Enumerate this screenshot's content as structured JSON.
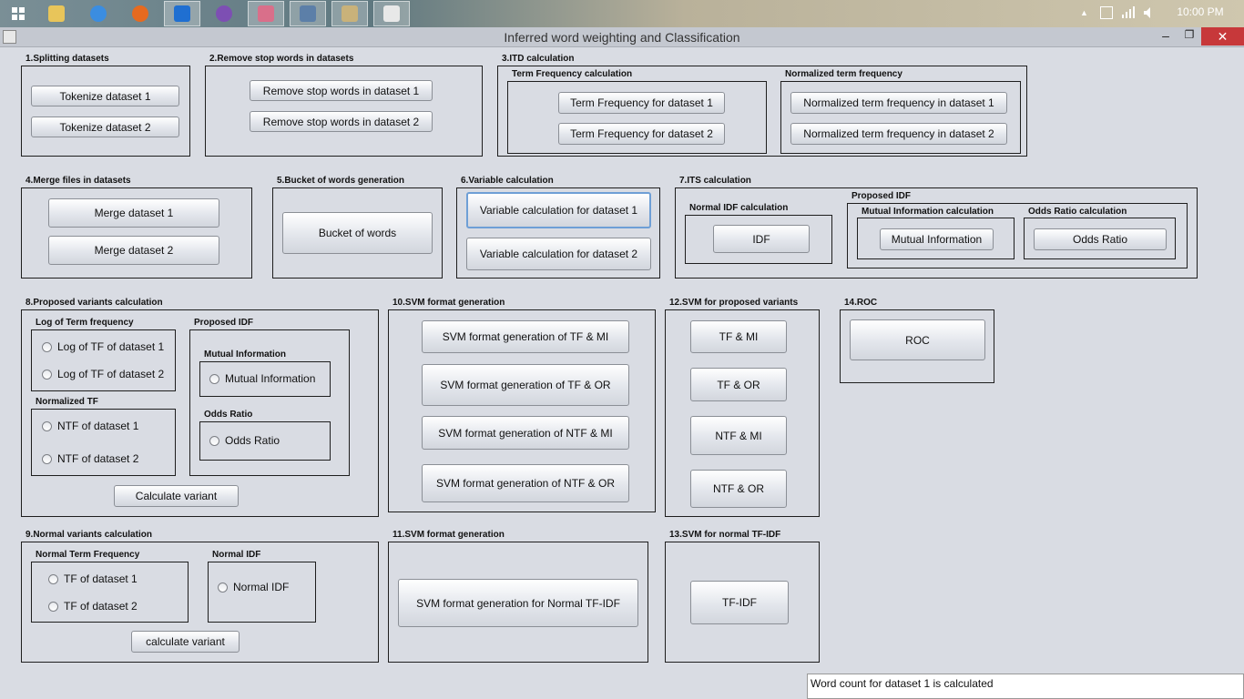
{
  "taskbar": {
    "icons": [
      "windows-start-icon",
      "file-explorer-icon",
      "internet-explorer-icon",
      "firefox-icon",
      "teamviewer-icon",
      "viber-icon",
      "app-icon",
      "box-icon",
      "paint-icon",
      "java-app-icon"
    ],
    "time": "10:00 PM"
  },
  "window": {
    "title": "Inferred word weighting and Classification"
  },
  "p1": {
    "label": "1.Splitting datasets",
    "b1": "Tokenize dataset 1",
    "b2": "Tokenize dataset 2"
  },
  "p2": {
    "label": "2.Remove stop words in datasets",
    "b1": "Remove stop words in dataset 1",
    "b2": "Remove stop words in dataset 2"
  },
  "p3": {
    "label": "3.ITD calculation",
    "tf": {
      "label": "Term Frequency calculation",
      "b1": "Term Frequency for dataset 1",
      "b2": "Term Frequency for dataset 2"
    },
    "ntf": {
      "label": "Normalized term frequency",
      "b1": "Normalized term frequency in dataset 1",
      "b2": "Normalized term frequency in dataset 2"
    }
  },
  "p4": {
    "label": "4.Merge files in datasets",
    "b1": "Merge dataset 1",
    "b2": "Merge dataset 2"
  },
  "p5": {
    "label": "5.Bucket of words generation",
    "b1": "Bucket of words"
  },
  "p6": {
    "label": "6.Variable calculation",
    "b1": "Variable calculation for dataset 1",
    "b2": "Variable calculation for dataset 2"
  },
  "p7": {
    "label": "7.ITS calculation",
    "normal": {
      "label": "Normal IDF calculation",
      "b1": "IDF"
    },
    "proposed": {
      "label": "Proposed IDF",
      "mi": {
        "label": "Mutual Information calculation",
        "b1": "Mutual Information"
      },
      "or": {
        "label": "Odds Ratio calculation",
        "b1": "Odds Ratio"
      }
    }
  },
  "p8": {
    "label": "8.Proposed variants calculation",
    "log": {
      "label": "Log of Term frequency",
      "r1": "Log of TF of dataset 1",
      "r2": "Log of TF of dataset 2"
    },
    "ntf": {
      "label": "Normalized TF",
      "r1": "NTF of dataset 1",
      "r2": "NTF of dataset 2"
    },
    "pidf": {
      "label": "Proposed IDF",
      "mi": {
        "label": "Mutual Information",
        "r1": "Mutual Information"
      },
      "or": {
        "label": "Odds Ratio",
        "r1": "Odds Ratio"
      }
    },
    "btn": "Calculate variant"
  },
  "p9": {
    "label": "9.Normal variants calculation",
    "ntf": {
      "label": "Normal Term Frequency",
      "r1": "TF of dataset 1",
      "r2": "TF of dataset 2"
    },
    "nidf": {
      "label": "Normal IDF",
      "r1": "Normal IDF"
    },
    "btn": "calculate variant"
  },
  "p10": {
    "label": "10.SVM format generation",
    "b1": "SVM format generation of TF & MI",
    "b2": "SVM format generation of TF & OR",
    "b3": "SVM format generation of NTF & MI",
    "b4": "SVM format generation of NTF & OR"
  },
  "p11": {
    "label": "11.SVM format generation",
    "b1": "SVM format generation for Normal TF-IDF"
  },
  "p12": {
    "label": "12.SVM for proposed variants",
    "b1": "TF & MI",
    "b2": "TF & OR",
    "b3": "NTF & MI",
    "b4": "NTF & OR"
  },
  "p13": {
    "label": "13.SVM for normal TF-IDF",
    "b1": "TF-IDF"
  },
  "p14": {
    "label": "14.ROC",
    "b1": "ROC"
  },
  "status": {
    "text": "Word count for dataset 1 is calculated"
  }
}
